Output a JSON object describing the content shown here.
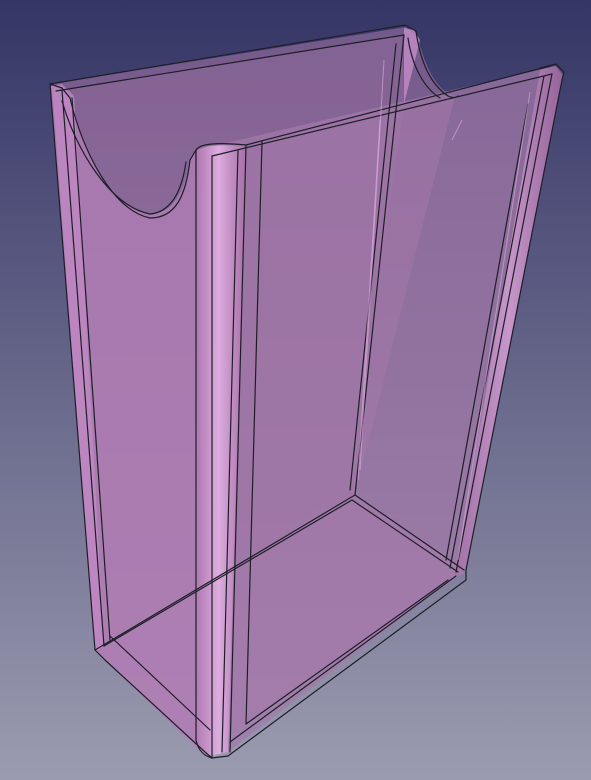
{
  "viewport": {
    "background": {
      "top_color": "#353566",
      "bottom_color": "#9b9bb0"
    }
  },
  "model": {
    "part": "transparent-box-holder",
    "face_color": "#c68ac6",
    "face_opacity": 0.6,
    "edge_color": "#1e1e28",
    "highlight_color": "#e8b6e8",
    "visible_features": [
      "back-wall-with-semicircular-cutout",
      "front-wall",
      "left-side-wall",
      "right-side-wall",
      "bottom-plate",
      "rounded-vertical-corner-posts"
    ]
  }
}
